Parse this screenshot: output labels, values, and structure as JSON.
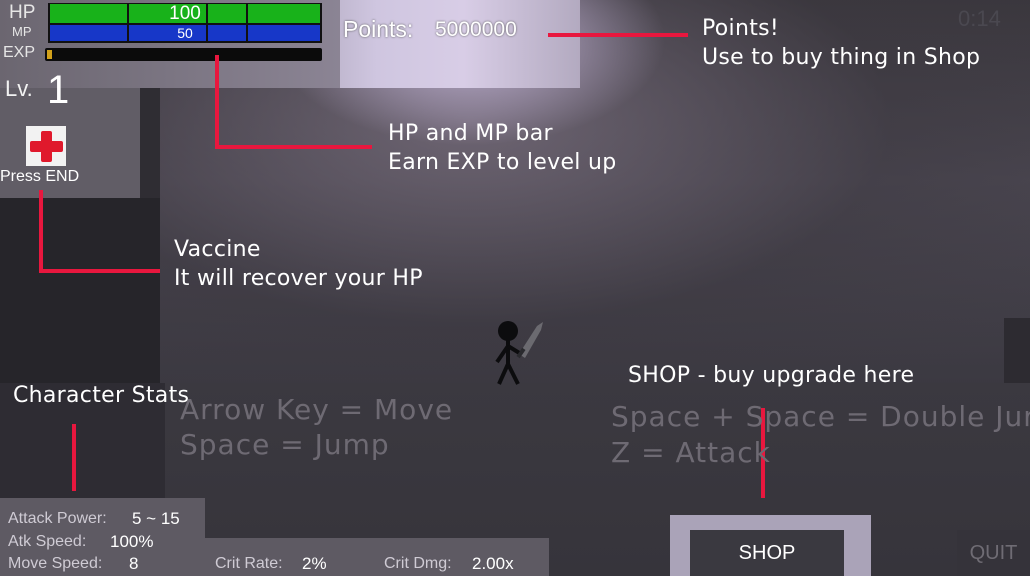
{
  "hud": {
    "hp_label": "HP",
    "mp_label": "MP",
    "exp_label": "EXP",
    "hp_value": "100",
    "mp_value": "50",
    "hp_fill_fraction": 1.0,
    "mp_fill_fraction": 1.0,
    "exp_fill_fraction": 0.02,
    "level_label": "Lv.",
    "level_value": "1",
    "vaccine_hint": "Press END",
    "points_label": "Points:",
    "points_value": "5000000",
    "timer": "0:14"
  },
  "annotations": {
    "points_line1": "Points!",
    "points_line2": "Use to buy thing in Shop",
    "bars_line1": "HP and MP bar",
    "bars_line2": "Earn EXP to level up",
    "vaccine_line1": "Vaccine",
    "vaccine_line2": "It will recover your HP",
    "shop_note": "SHOP - buy upgrade here",
    "stats_note": "Character Stats"
  },
  "tutorial": {
    "move": "Arrow Key = Move",
    "jump": "Space = Jump",
    "double_jump": "Space + Space = Double Jur",
    "attack": "Z = Attack"
  },
  "stats": {
    "attack_power_label": "Attack Power:",
    "attack_power_value": "5 ~ 15",
    "atk_speed_label": "Atk Speed:",
    "atk_speed_value": "100%",
    "move_speed_label": "Move Speed:",
    "move_speed_value": "8",
    "crit_rate_label": "Crit Rate:",
    "crit_rate_value": "2%",
    "crit_dmg_label": "Crit Dmg:",
    "crit_dmg_value": "2.00x"
  },
  "buttons": {
    "shop": "SHOP",
    "quit": "QUIT"
  },
  "colors": {
    "hp": "#18b21a",
    "mp": "#1737c8",
    "exp": "#d2a11a",
    "annotation": "#e8173e",
    "vaccine_cross": "#e0192c"
  },
  "icons": {
    "vaccine": "red-cross-icon",
    "player": "stickman-with-sword"
  }
}
